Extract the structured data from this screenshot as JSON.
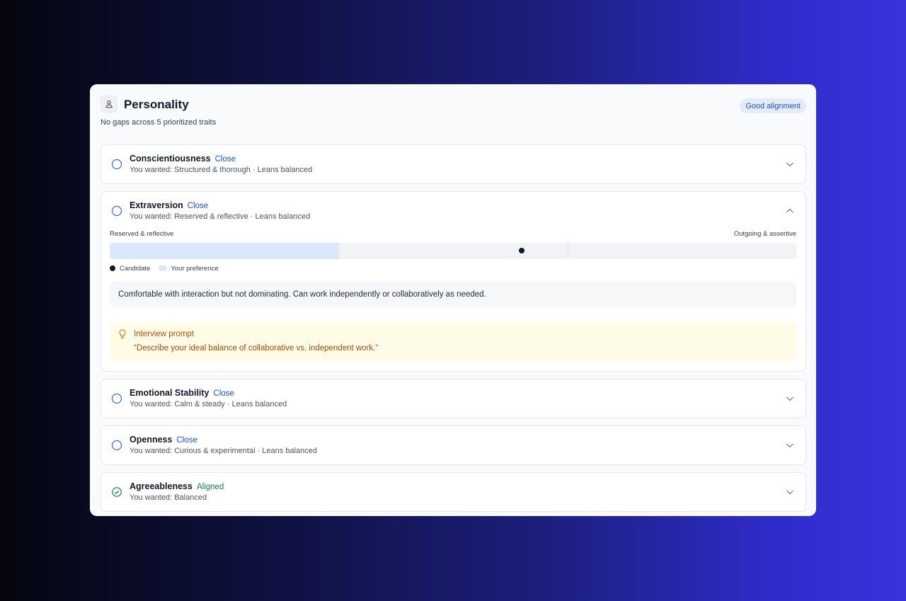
{
  "header": {
    "title": "Personality",
    "subtitle": "No gaps across 5 prioritized traits",
    "badge": "Good alignment",
    "icon": "person-icon"
  },
  "colors": {
    "accent": "#1d4ed8",
    "aligned": "#15803d",
    "preference_fill": "#dbe7fb",
    "prompt_bg": "#fefbe6",
    "prompt_text": "#b45309"
  },
  "traits": [
    {
      "name": "Conscientiousness",
      "tag": "Close",
      "wanted": "You wanted: Structured & thorough · Leans balanced",
      "expanded": false
    },
    {
      "name": "Extraversion",
      "tag": "Close",
      "wanted": "You wanted: Reserved & reflective · Leans balanced",
      "expanded": true,
      "scale": {
        "left_label": "Reserved & reflective",
        "right_label": "Outgoing & assertive",
        "preference_range": [
          0,
          0.3333
        ],
        "candidate_position": 0.6
      },
      "legend": {
        "candidate": "Candidate",
        "preference": "Your preference"
      },
      "description": "Comfortable with interaction but not dominating. Can work independently or collaboratively as needed.",
      "prompt": {
        "title": "Interview prompt",
        "text": "“Describe your ideal balance of collaborative vs. independent work.”"
      }
    },
    {
      "name": "Emotional Stability",
      "tag": "Close",
      "wanted": "You wanted: Calm & steady · Leans balanced",
      "expanded": false
    },
    {
      "name": "Openness",
      "tag": "Close",
      "wanted": "You wanted: Curious & experimental · Leans balanced",
      "expanded": false
    },
    {
      "name": "Agreeableness",
      "tag": "Aligned",
      "wanted": "You wanted: Balanced",
      "expanded": false
    }
  ]
}
